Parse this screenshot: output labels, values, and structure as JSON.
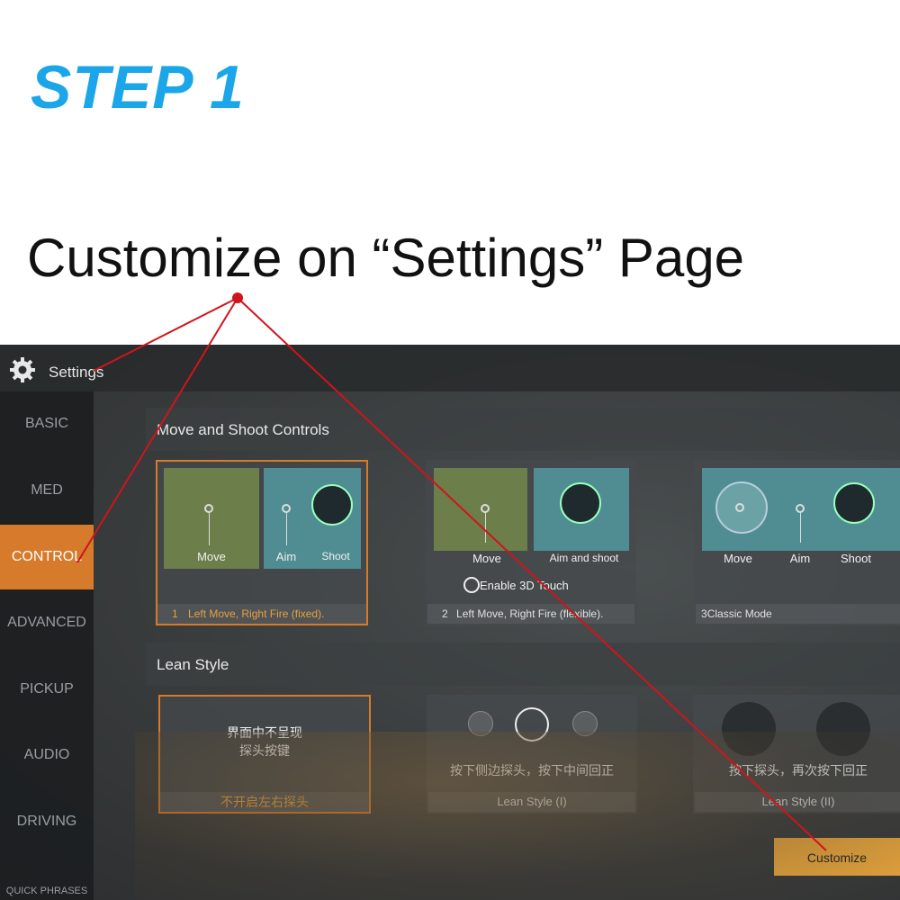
{
  "step": "STEP 1",
  "subtitle": "Customize on “Settings” Page",
  "colors": {
    "accent": "#1aa6e8",
    "active_tab": "#d67a2c",
    "customize_button": "#e8a53c",
    "pointer_lines": "#d0141c"
  },
  "header": {
    "title": "Settings",
    "icon": "gear-icon"
  },
  "sidebar": {
    "items": [
      "BASIC",
      "MED",
      "CONTROL",
      "ADVANCED",
      "PICKUP",
      "AUDIO",
      "DRIVING",
      "QUICK PHRASES"
    ],
    "active": "CONTROL"
  },
  "move_shoot": {
    "title": "Move and Shoot Controls",
    "modes": [
      {
        "labels": [
          "Move",
          "Aim",
          "Shoot"
        ],
        "caption_num": "1",
        "caption": "Left Move, Right Fire (fixed)."
      },
      {
        "labels": [
          "Move",
          "Aim and shoot"
        ],
        "option": "Enable 3D Touch",
        "caption_num": "2",
        "caption": "Left Move, Right Fire (flexible)."
      },
      {
        "labels": [
          "Move",
          "Aim",
          "Shoot"
        ],
        "caption_num": "3",
        "caption": "Classic Mode"
      }
    ]
  },
  "lean": {
    "title": "Lean Style",
    "options": [
      {
        "text_line1": "界面中不呈现",
        "text_line2": "探头按键",
        "caption": "不开启左右探头"
      },
      {
        "text": "按下侧边探头，按下中间回正",
        "caption": "Lean Style (I)"
      },
      {
        "text": "按下探头，再次按下回正",
        "caption": "Lean Style (II)"
      }
    ]
  },
  "customize_label": "Customize"
}
